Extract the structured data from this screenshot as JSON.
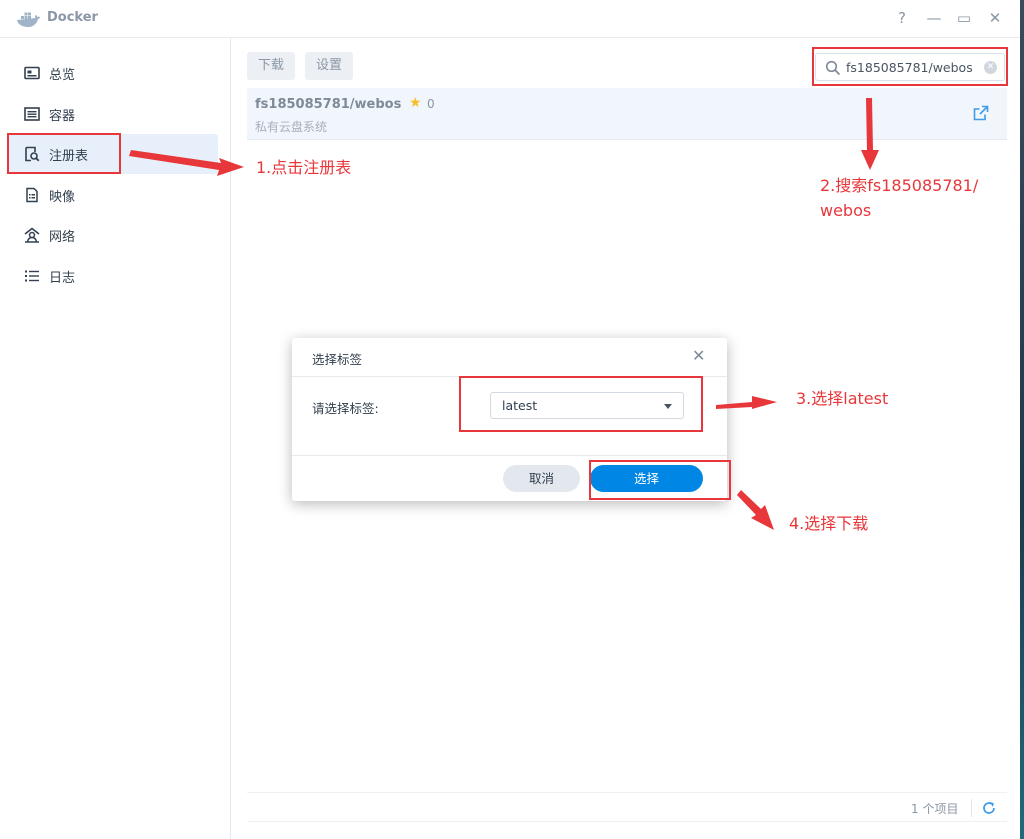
{
  "window": {
    "title": "Docker",
    "controls": {
      "help": "?",
      "minimize": "—",
      "maximize": "▭",
      "close": "✕"
    }
  },
  "sidebar": {
    "items": [
      {
        "label": "总览",
        "icon": "overview-icon"
      },
      {
        "label": "容器",
        "icon": "container-icon"
      },
      {
        "label": "注册表",
        "icon": "registry-icon",
        "active": true
      },
      {
        "label": "映像",
        "icon": "image-icon"
      },
      {
        "label": "网络",
        "icon": "network-icon"
      },
      {
        "label": "日志",
        "icon": "log-icon"
      }
    ]
  },
  "toolbar": {
    "download_label": "下载",
    "settings_label": "设置",
    "search_value": "fs185085781/webos"
  },
  "results": [
    {
      "name": "fs185085781/webos",
      "stars": "0",
      "description": "私有云盘系统"
    }
  ],
  "footer": {
    "count_text": "1 个项目"
  },
  "dialog": {
    "title": "选择标签",
    "close": "✕",
    "label": "请选择标签:",
    "selected_tag": "latest",
    "cancel_label": "取消",
    "choose_label": "选择"
  },
  "annotations": {
    "step1": "1.点击注册表",
    "step2_line1": "2.搜索fs185085781/",
    "step2_line2": "webos",
    "step3": "3.选择latest",
    "step4": "4.选择下载"
  },
  "colors": {
    "accent": "#0086e5",
    "annotation": "#e8373a",
    "active_nav": "#e7f0fa",
    "star": "#f6c02b"
  }
}
